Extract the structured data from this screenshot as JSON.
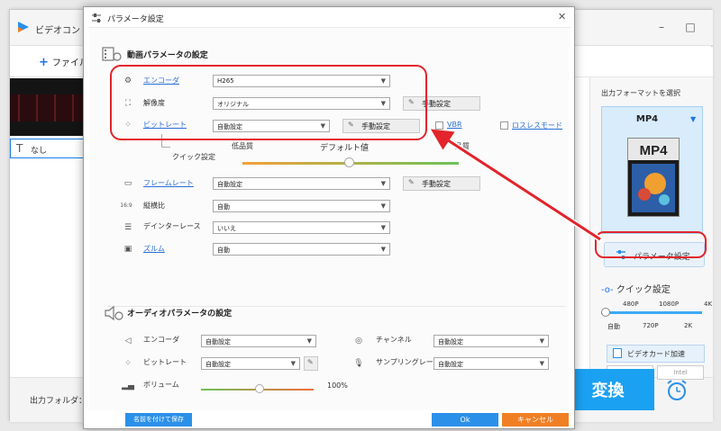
{
  "main_window": {
    "title": "ビデオコン",
    "add_file": "ファイル",
    "subtitle_none": "なし",
    "output_folder_label": "出力フォルダ："
  },
  "right_panel": {
    "format_label": "出力フォーマットを選択",
    "format_name": "MP4",
    "param_button": "パラメータ設定",
    "quick_setting": "クイック設定",
    "quick_top_ticks": [
      "480P",
      "1080P",
      "4K"
    ],
    "quick_bottom_ticks": [
      "自動",
      "720P",
      "2K"
    ],
    "gpu_label": "ビデオカード加速",
    "nvidia": "NVIDIA",
    "intel": "Intel",
    "convert": "変換"
  },
  "dialog": {
    "title": "パラメータ設定",
    "video_section": "動画パラメータの設定",
    "encoder_label": "エンコーダ",
    "encoder_value": "H265",
    "resolution_label": "解像度",
    "resolution_value": "オリジナル",
    "bitrate_label": "ビットレート",
    "bitrate_value": "自動設定",
    "manual_setting": "手動設定",
    "vbr_label": "VBR",
    "lossless_label": "ロスレスモード",
    "quick_setting_label": "クイック設定",
    "quality_low": "低品質",
    "quality_default": "デフォルト値",
    "quality_high": "品質",
    "framerate_label": "フレームレート",
    "framerate_value": "自動設定",
    "aspect_label": "縦横比",
    "aspect_value": "自動",
    "deinterlace_label": "デインターレース",
    "deinterlace_value": "いいえ",
    "zoom_label": "ズルム",
    "zoom_value": "自動",
    "audio_section": "オーディオパラメータの設定",
    "audio_encoder_label": "エンコーダ",
    "audio_encoder_value": "自動設定",
    "audio_bitrate_label": "ビットレート",
    "audio_bitrate_value": "自動設定",
    "volume_label": "ボリューム",
    "volume_value": "100%",
    "channel_label": "チャンネル",
    "channel_value": "自動設定",
    "sampling_label": "サンプリングレート",
    "sampling_value": "自動設定",
    "save_as": "名前を付けて保存",
    "ok": "Ok",
    "cancel": "キャンセル"
  },
  "colors": {
    "accent_blue": "#1ba1f2",
    "highlight_red": "#e3242b",
    "cancel_orange": "#f07f24"
  }
}
